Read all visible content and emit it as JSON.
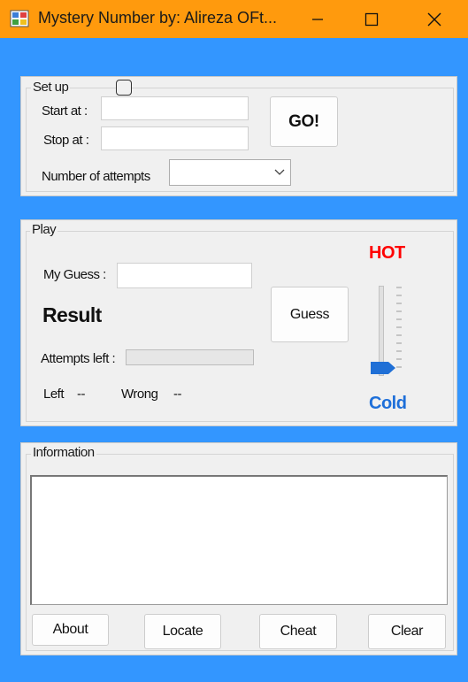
{
  "window": {
    "title": "Mystery Number by: Alireza OFt..."
  },
  "setup": {
    "legend": "Set up",
    "start_label": "Start at :",
    "start_value": "",
    "stop_label": "Stop at :",
    "stop_value": "",
    "attempts_label": "Number of attempts",
    "attempts_selected": "",
    "go_label": "GO!"
  },
  "play": {
    "legend": "Play",
    "guess_label": "My Guess :",
    "guess_value": "",
    "result_label": "Result",
    "attempts_left_label": "Attempts left :",
    "attempts_left_progress": 0,
    "left_label": "Left",
    "left_value": "--",
    "wrong_label": "Wrong",
    "wrong_value": "--",
    "guess_button": "Guess",
    "hot_label": "HOT",
    "cold_label": "Cold",
    "hot_color": "#ff0000",
    "cold_color": "#1e6fd9",
    "slider_level": 0
  },
  "information": {
    "legend": "Information",
    "text": "",
    "about_button": "About",
    "locate_button": "Locate",
    "cheat_button": "Cheat",
    "clear_button": "Clear"
  }
}
